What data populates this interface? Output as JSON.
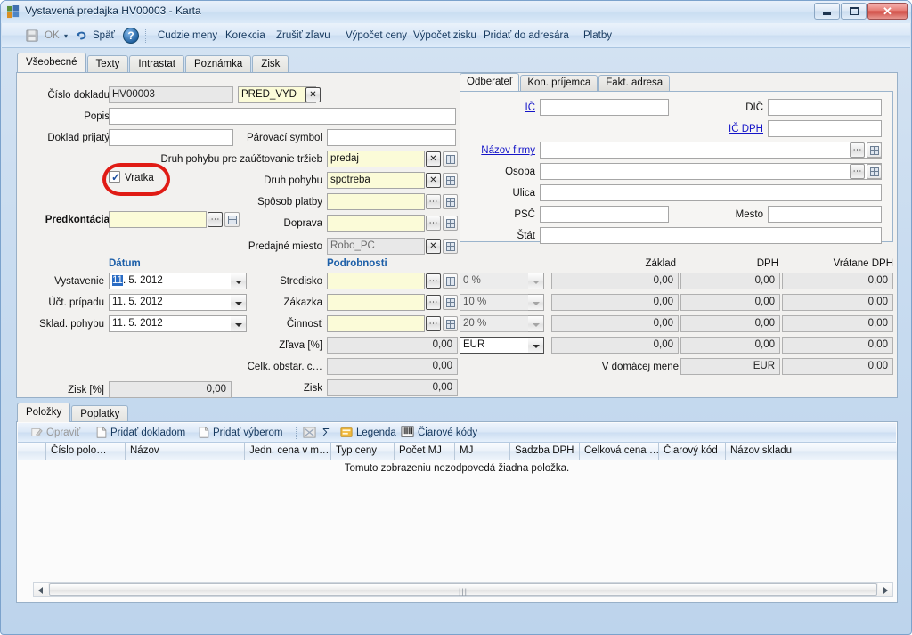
{
  "window": {
    "title": "Vystavená predajka HV00003 - Karta",
    "icon": "app-icon",
    "controls": {
      "minimize": "minimize-icon",
      "maximize": "maximize-icon",
      "close": "✕"
    }
  },
  "toolbar": {
    "ok": "OK",
    "back": "Späť",
    "help": "?",
    "items": [
      "Cudzie meny",
      "Korekcia",
      "Zrušiť zľavu",
      "Výpočet ceny",
      "Výpočet zisku",
      "Pridať do adresára",
      "Platby"
    ]
  },
  "tabs": {
    "items": [
      "Všeobecné",
      "Texty",
      "Intrastat",
      "Poznámka",
      "Zisk"
    ],
    "active": "Všeobecné"
  },
  "form": {
    "cislo_dokladu": {
      "label": "Číslo dokladu",
      "value": "HV00003"
    },
    "doc_type": {
      "value": "PRED_VYD",
      "clear": "✕"
    },
    "popis": {
      "label": "Popis",
      "value": ""
    },
    "doklad_prijaty": {
      "label": "Doklad prijatý",
      "value": ""
    },
    "parovaci_symbol": {
      "label": "Párovací symbol",
      "value": ""
    },
    "druh_pohybu_trzieb": {
      "label": "Druh pohybu pre zaúčtovanie tržieb",
      "value": "predaj"
    },
    "druh_pohybu": {
      "label": "Druh pohybu",
      "value": "spotreba"
    },
    "sposob_platby": {
      "label": "Spôsob platby",
      "value": ""
    },
    "doprava": {
      "label": "Doprava",
      "value": ""
    },
    "predajne_miesto": {
      "label": "Predajné miesto",
      "value": "Robo_PC"
    },
    "vratka": {
      "label": "Vratka",
      "checked": true
    },
    "predkontacia": {
      "label": "Predkontácia",
      "value": ""
    },
    "datum": {
      "heading": "Dátum",
      "rows": [
        {
          "label": "Vystavenie",
          "sel": "11",
          "rest": ". 5. 2012"
        },
        {
          "label": "Účt. prípadu",
          "value": "11. 5. 2012"
        },
        {
          "label": "Sklad. pohybu",
          "value": "11. 5. 2012"
        }
      ]
    },
    "podrobnosti": {
      "heading": "Podrobnosti",
      "stredisko": {
        "label": "Stredisko",
        "value": ""
      },
      "zakazka": {
        "label": "Zákazka",
        "value": ""
      },
      "cinnost": {
        "label": "Činnosť",
        "value": ""
      },
      "zlava": {
        "label": "Zľava [%]",
        "value": "0,00"
      },
      "celk_obstar": {
        "label": "Celk. obstar. c…",
        "value": "0,00"
      },
      "zisk": {
        "label": "Zisk",
        "value": "0,00"
      }
    },
    "zisk_pct": {
      "label": "Zisk [%]",
      "value": "0,00"
    }
  },
  "partner": {
    "tabs": [
      "Odberateľ",
      "Kon. príjemca",
      "Fakt. adresa"
    ],
    "active": "Odberateľ",
    "ic": {
      "label": "IČ",
      "value": ""
    },
    "dic": {
      "label": "DIČ",
      "value": ""
    },
    "ic_dph": {
      "label": "IČ DPH",
      "value": ""
    },
    "nazov_firmy": {
      "label": "Názov firmy",
      "value": ""
    },
    "osoba": {
      "label": "Osoba",
      "value": ""
    },
    "ulica": {
      "label": "Ulica",
      "value": ""
    },
    "psc": {
      "label": "PSČ",
      "value": ""
    },
    "mesto": {
      "label": "Mesto",
      "value": ""
    },
    "stat": {
      "label": "Štát",
      "value": ""
    }
  },
  "totals": {
    "headers": [
      "Základ",
      "DPH",
      "Vrátane DPH"
    ],
    "rows": [
      {
        "rate": "0 %",
        "zaklad": "0,00",
        "dph": "0,00",
        "vratane": "0,00"
      },
      {
        "rate": "10 %",
        "zaklad": "0,00",
        "dph": "0,00",
        "vratane": "0,00"
      },
      {
        "rate": "20 %",
        "zaklad": "0,00",
        "dph": "0,00",
        "vratane": "0,00"
      }
    ],
    "currency": "EUR",
    "sum": {
      "zaklad": "0,00",
      "dph": "0,00",
      "vratane": "0,00"
    },
    "domestic": {
      "label": "V domácej mene",
      "currency": "EUR",
      "value": "0,00"
    }
  },
  "items_section": {
    "tabs": [
      "Položky",
      "Poplatky"
    ],
    "active": "Položky",
    "toolbar": {
      "opravit": "Opraviť",
      "pridat_dokladom": "Pridať dokladom",
      "pridat_vyberom": "Pridať výberom",
      "sum": "Σ",
      "legenda": "Legenda",
      "ciarove_kody": "Čiarové kódy"
    },
    "columns": [
      "Číslo polo…",
      "Názov",
      "Jedn. cena v m…",
      "Typ ceny",
      "Počet MJ",
      "MJ",
      "Sadzba DPH",
      "Celková cena …",
      "Čiarový kód",
      "Názov skladu"
    ],
    "empty_message": "Tomuto zobrazeniu nezodpovedá žiadna položka."
  },
  "colors": {
    "accent": "#1d5fa8",
    "link": "#1414c8",
    "annotation": "#e01b15",
    "yellow_field": "#fbfbd8",
    "window_chrome": "#c9dcf0"
  }
}
